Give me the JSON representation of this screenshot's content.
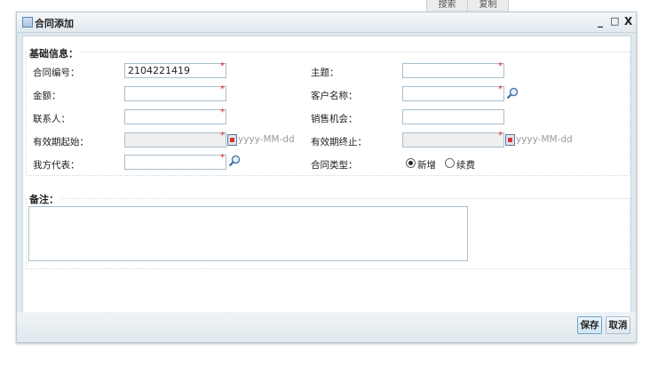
{
  "top_tabs": [
    "搜索",
    "复制"
  ],
  "window": {
    "title": "合同添加",
    "min": "_",
    "max": "□",
    "close": "X"
  },
  "basic": {
    "legend": "基础信息：",
    "contract_no": {
      "label": "合同编号：",
      "value": "2104221419"
    },
    "subject": {
      "label": "主题："
    },
    "amount": {
      "label": "金额："
    },
    "customer": {
      "label": "客户名称："
    },
    "contact": {
      "label": "联系人："
    },
    "opportunity": {
      "label": "销售机会："
    },
    "valid_start": {
      "label": "有效期起始：",
      "placeholder": "yyyy-MM-dd"
    },
    "valid_end": {
      "label": "有效期终止：",
      "placeholder": "yyyy-MM-dd"
    },
    "representative": {
      "label": "我方代表："
    },
    "contract_type": {
      "label": "合同类型：",
      "options": [
        "新增",
        "续费"
      ],
      "selected": "新增"
    }
  },
  "remarks": {
    "legend": "备注："
  },
  "required_mark": "*",
  "footer": {
    "save": "保存",
    "cancel": "取消"
  }
}
